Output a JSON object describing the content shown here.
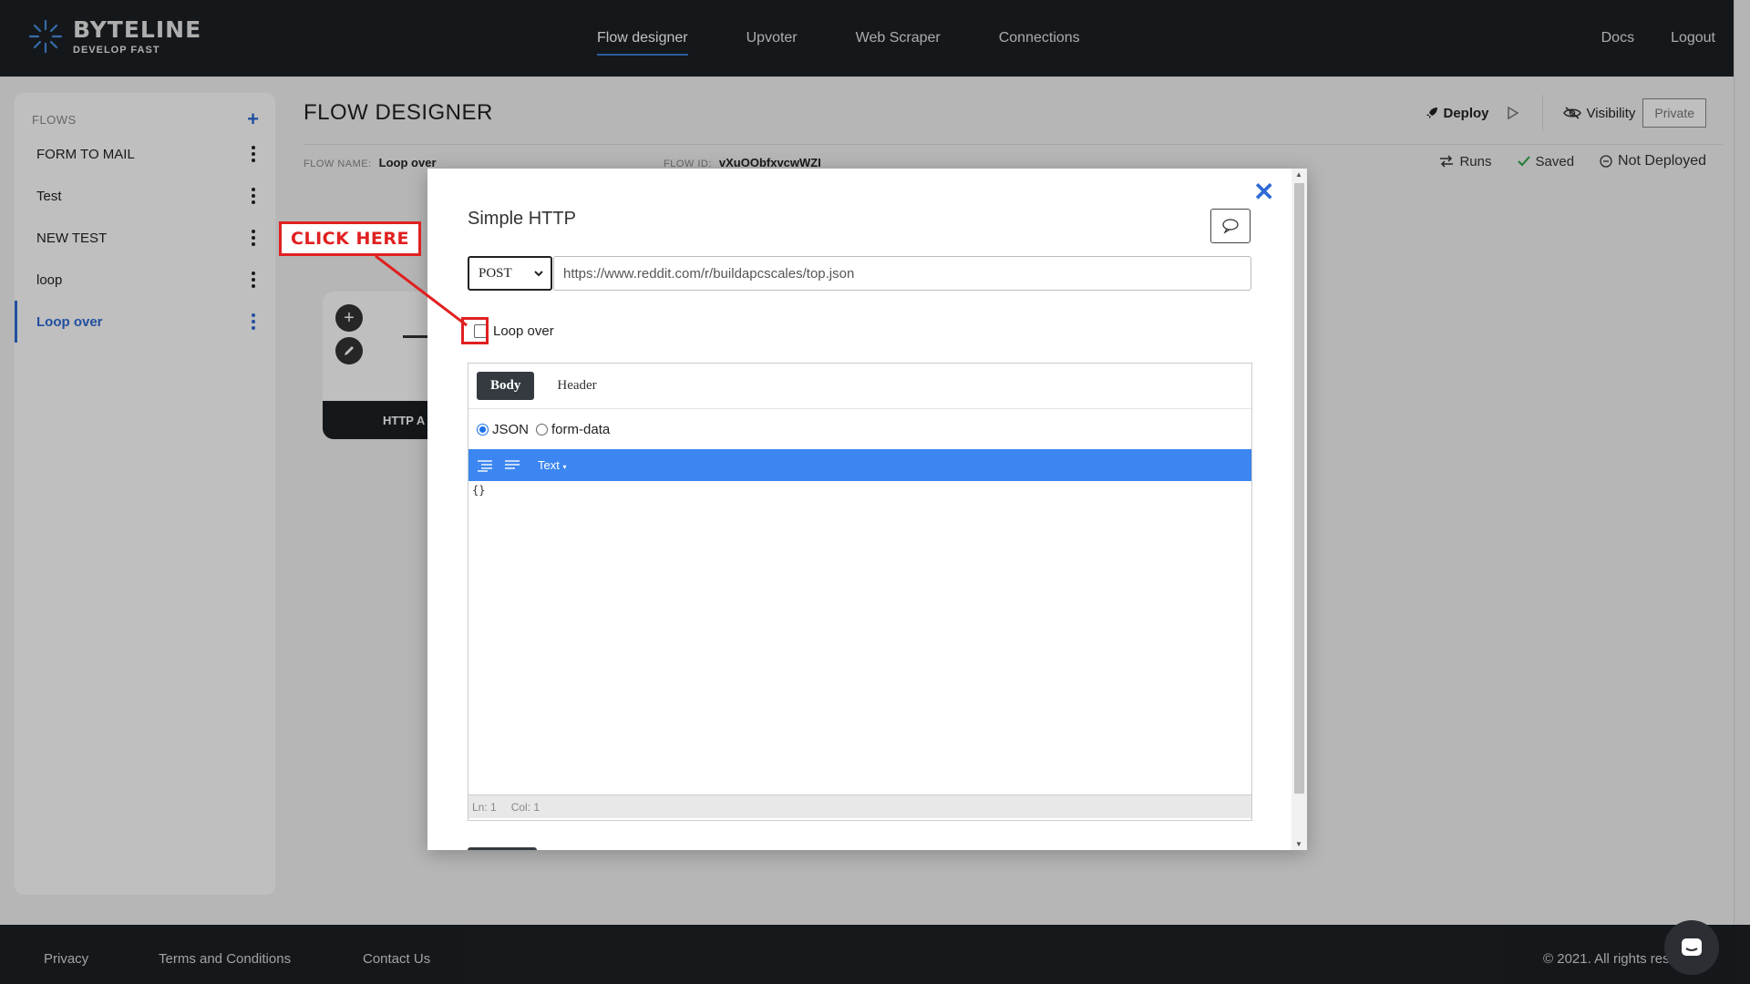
{
  "brand": {
    "title": "BYTELINE",
    "tagline": "DEVELOP FAST"
  },
  "nav": {
    "center": [
      "Flow designer",
      "Upvoter",
      "Web Scraper",
      "Connections"
    ],
    "right": [
      "Docs",
      "Logout"
    ]
  },
  "sidebar": {
    "header": "FLOWS",
    "items": [
      "FORM TO MAIL",
      "Test",
      "NEW TEST",
      "loop",
      "Loop over"
    ]
  },
  "page": {
    "title": "FLOW DESIGNER",
    "flow_name_label": "FLOW NAME:",
    "flow_name": "Loop over",
    "flow_id_label": "FLOW ID:",
    "flow_id": "vXuOObfxvcwWZI"
  },
  "toolbar": {
    "deploy": "Deploy",
    "visibility": "Visibility",
    "private": "Private"
  },
  "status": {
    "runs": "Runs",
    "saved": "Saved",
    "deployed": "Not Deployed"
  },
  "node": {
    "label": "HTTP A"
  },
  "modal": {
    "title": "Simple HTTP",
    "method": "POST",
    "url": "https://www.reddit.com/r/buildapcscales/top.json",
    "loop_label": "Loop over",
    "tabs": [
      "Body",
      "Header"
    ],
    "radio_json": "JSON",
    "radio_form": "form-data",
    "editor_mode": "Text",
    "editor_content": "{}",
    "status_ln": "Ln: 1",
    "status_col": "Col: 1"
  },
  "annotation": {
    "callout": "CLICK HERE"
  },
  "footer": {
    "links": [
      "Privacy",
      "Terms and Conditions",
      "Contact Us"
    ],
    "copyright": "© 2021. All rights rese"
  },
  "colors": {
    "accent": "#2d6bd6",
    "dark": "#1d2124",
    "editor_bar": "#3b86f1",
    "annotation": "#e02020"
  }
}
